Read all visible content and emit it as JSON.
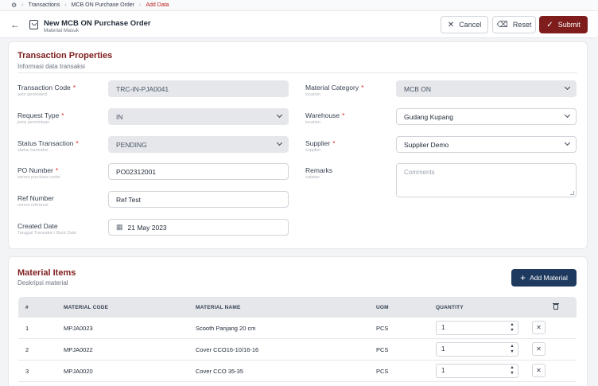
{
  "breadcrumb": {
    "home_icon": "settings-icon",
    "items": [
      "Transactions",
      "MCB ON Purchase Order",
      "Add Data"
    ]
  },
  "header": {
    "back_icon": "arrow-left-icon",
    "doc_icon": "clipboard-icon",
    "title": "New MCB ON Purchase Order",
    "subtitle": "Material Masuk",
    "cancel_label": "Cancel",
    "reset_label": "Reset",
    "submit_label": "Submit"
  },
  "properties": {
    "title": "Transaction Properties",
    "subtitle": "Informasi data transaksi",
    "transaction_code": {
      "label": "Transaction Code",
      "hint": "auto generated",
      "value": "TRC-IN-PJA0041"
    },
    "request_type": {
      "label": "Request Type",
      "hint": "jenis permintaan",
      "value": "IN"
    },
    "status": {
      "label": "Status Transaction",
      "hint": "status transaksi",
      "value": "PENDING"
    },
    "po_number": {
      "label": "PO Number",
      "hint": "nomor purchase order",
      "value": "PO02312001"
    },
    "ref_number": {
      "label": "Ref Number",
      "hint": "nomor referensi",
      "value": "Ref Test"
    },
    "created_date": {
      "label": "Created Date",
      "hint": "Tanggal Transaksi / Back Date",
      "value": "21 May 2023"
    },
    "material_category": {
      "label": "Material Category",
      "hint": "location",
      "value": "MCB ON"
    },
    "warehouse": {
      "label": "Warehouse",
      "hint": "location",
      "value": "Gudang Kupang"
    },
    "supplier": {
      "label": "Supplier",
      "hint": "supplier",
      "value": "Supplier Demo"
    },
    "remarks": {
      "label": "Remarks",
      "hint": "catatan",
      "placeholder": "Comments"
    }
  },
  "items": {
    "title": "Material Items",
    "subtitle": "Deskripsi material",
    "add_label": "Add Material",
    "columns": [
      "#",
      "MATERIAL CODE",
      "MATERIAL NAME",
      "UOM",
      "QUANTITY"
    ],
    "rows": [
      {
        "no": "1",
        "code": "MPJA0023",
        "name": "Scooth Panjang 20 cm",
        "uom": "PCS",
        "qty": "1"
      },
      {
        "no": "2",
        "code": "MPJA0022",
        "name": "Cover CCO16-10/16-16",
        "uom": "PCS",
        "qty": "1"
      },
      {
        "no": "3",
        "code": "MPJA0020",
        "name": "Cover CCO 35-35",
        "uom": "PCS",
        "qty": "1"
      }
    ]
  },
  "colors": {
    "brand": "#7f1d1d",
    "accent": "#1e3a5f",
    "required": "#dc2626"
  }
}
